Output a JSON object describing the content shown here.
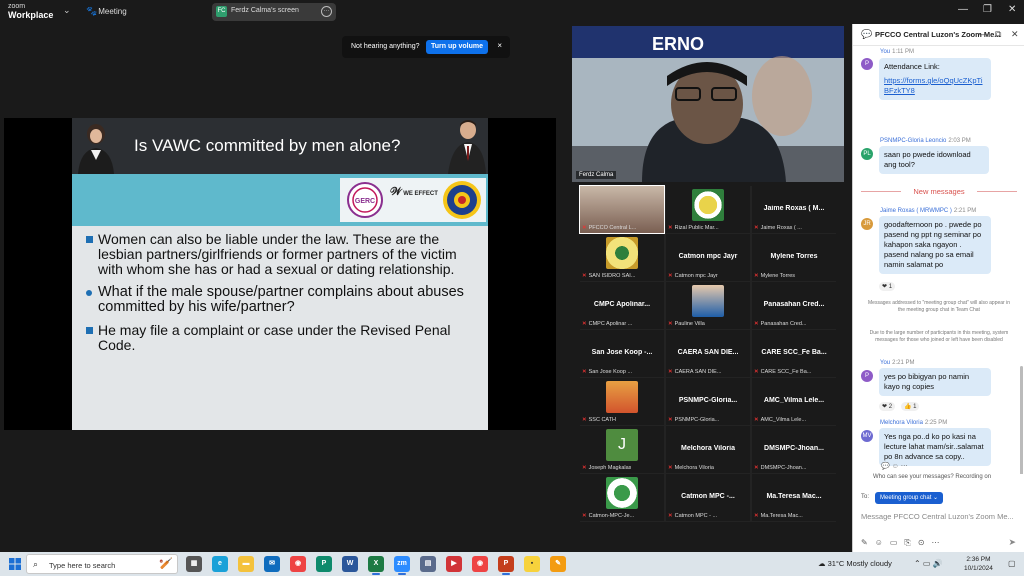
{
  "app": {
    "brand_line1": "zoom",
    "brand_line2": "Workplace",
    "meeting_label": "Meeting",
    "share_label": "Ferdz Calma's screen",
    "share_initials": "FC"
  },
  "toast": {
    "text": "Not hearing anything?",
    "button": "Turn up volume",
    "close": "×"
  },
  "slide": {
    "title": "Is VAWC committed by men alone?",
    "logo_we": "WE EFFECT",
    "logo_gerc": "GERC",
    "bullets": [
      "Women can also be liable under the law. These are the lesbian partners/girlfriends or former partners of the victim with whom she has or had a sexual or dating relationship.",
      "What if the male spouse/partner complains about abuses committed by his wife/partner?",
      "He may file a complaint or case under the Revised Penal Code."
    ]
  },
  "speaker": {
    "name": "Ferdz Calma",
    "banner": "ERNO"
  },
  "gallery": {
    "tiles": [
      {
        "label": "PFCCO Central L...",
        "big": "",
        "avatar": "video"
      },
      {
        "label": "Rizal Public Mar...",
        "big": "",
        "avatar": "seal"
      },
      {
        "label": "Jaime Roxas ( ...",
        "big": "Jaime Roxas ( M...",
        "avatar": ""
      },
      {
        "label": "SAN ISIDRO SAI...",
        "big": "",
        "avatar": "seal2"
      },
      {
        "label": "Catmon mpc Jayr",
        "big": "Catmon mpc Jayr",
        "avatar": ""
      },
      {
        "label": "Mylene Torres",
        "big": "Mylene Torres",
        "avatar": ""
      },
      {
        "label": "CMPC Apolinar ...",
        "big": "CMPC Apolinar...",
        "avatar": ""
      },
      {
        "label": "Pauline Villa",
        "big": "",
        "avatar": "photo"
      },
      {
        "label": "Panasahan Cred...",
        "big": "Panasahan Cred...",
        "avatar": ""
      },
      {
        "label": "San Jose Koop ...",
        "big": "San Jose Koop -...",
        "avatar": ""
      },
      {
        "label": "CAERA SAN DIE...",
        "big": "CAERA SAN DIE...",
        "avatar": ""
      },
      {
        "label": "CARE SCC_Fe Ba...",
        "big": "CARE SCC_Fe Ba...",
        "avatar": ""
      },
      {
        "label": "SSC CATH",
        "big": "",
        "avatar": "bus"
      },
      {
        "label": "PSNMPC-Gloria...",
        "big": "PSNMPC-Gloria...",
        "avatar": ""
      },
      {
        "label": "AMC_Vilma Lele...",
        "big": "AMC_Vilma Lele...",
        "avatar": ""
      },
      {
        "label": "Joseph Magkalas",
        "big": "",
        "avatar": "J"
      },
      {
        "label": "Melchora Viloria",
        "big": "Melchora Viloria",
        "avatar": ""
      },
      {
        "label": "DMSMPC-Jhoan...",
        "big": "DMSMPC-Jhoan...",
        "avatar": ""
      },
      {
        "label": "Catmon-MPC-Je...",
        "big": "",
        "avatar": "seal3"
      },
      {
        "label": "Catmon MPC - ...",
        "big": "Catmon MPC -...",
        "avatar": ""
      },
      {
        "label": "Ma.Teresa Mac...",
        "big": "Ma.Teresa Mac...",
        "avatar": ""
      }
    ]
  },
  "chat": {
    "title": "PFCCO Central Luzon's Zoom Me...",
    "messages": [
      {
        "initial": "P",
        "color": "#8e5bc7",
        "sender": "You",
        "time": "1:11 PM",
        "text": "Attendance Link:",
        "link": "https://forms.gle/oQqUcZKpTiBFzkTY8"
      },
      {
        "initial": "PL",
        "color": "#2aa36b",
        "sender": "PSNMPC-Gloria Leoncio",
        "time": "2:03 PM",
        "text": "saan po pwede idownload ang tool?"
      },
      {
        "initial": "JR",
        "color": "#d89a3b",
        "sender": "Jaime Roxas ( MRWMPC )",
        "time": "2:21 PM",
        "text": "goodafternoon po . pwede po pasend ng ppt ng seminar po kahapon saka ngayon . pasend nalang po sa email namin salamat po",
        "reaction": "❤ 1"
      },
      {
        "initial": "P",
        "color": "#8e5bc7",
        "sender": "You",
        "time": "2:21 PM",
        "text": "yes po bibigyan po namin kayo ng copies",
        "reaction": "❤ 2",
        "reaction2": "👍 1"
      },
      {
        "initial": "MV",
        "color": "#6d6ad1",
        "sender": "Melchora Viloria",
        "time": "2:25 PM",
        "text": "Yes nga po..d ko po kasi na lecture lahat mam/sir..salamat po 8n advance sa copy.."
      }
    ],
    "new_messages": "New messages",
    "sys1": "Messages addressed to \"meeting group chat\" will also appear in the meeting group chat in Team Chat",
    "sys2": "Due to the large number of participants in this meeting, system messages for those who joined or left have been disabled",
    "recording": "Who can see your messages? Recording on",
    "to_label": "To:",
    "to_target": "Meeting group chat ⌄",
    "input_placeholder": "Message PFCCO Central Luzon's Zoom Me..."
  },
  "taskbar": {
    "search_placeholder": "Type here to search",
    "weather": "31°C  Mostly cloudy",
    "time": "2:36 PM",
    "date": "10/1/2024"
  }
}
